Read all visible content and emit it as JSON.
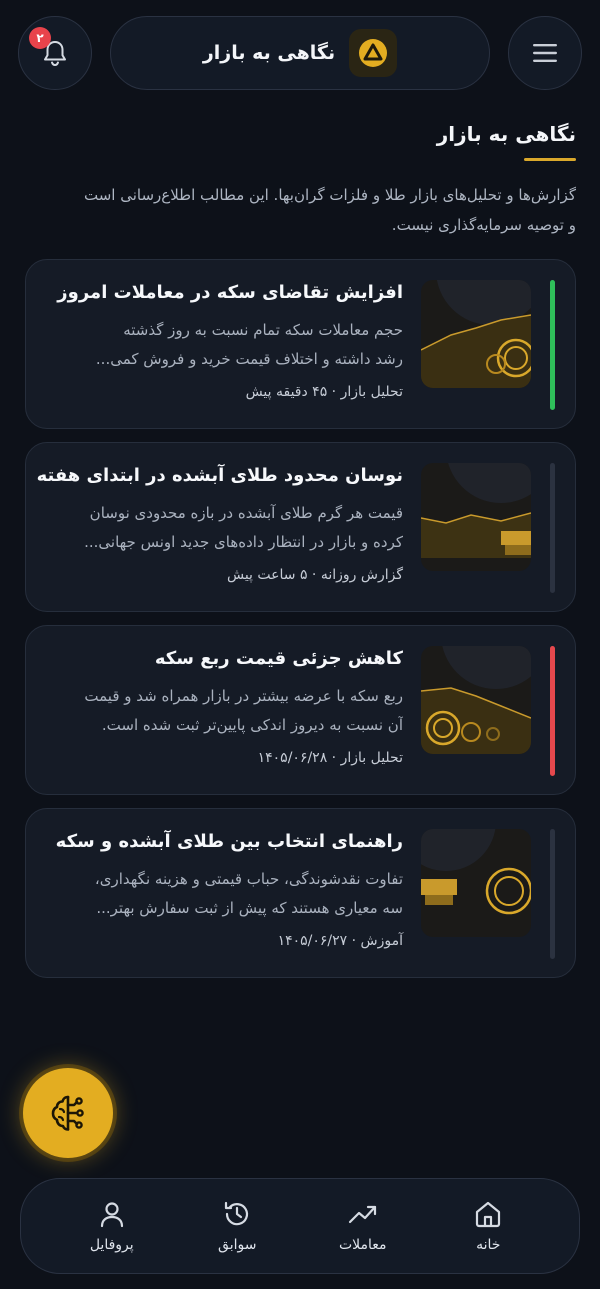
{
  "header": {
    "title": "نگاهی به بازار",
    "notification_count": "۲",
    "bell_icon": "bell-icon",
    "menu_icon": "hamburger-menu-icon",
    "logo_icon": "triangle-logo-icon"
  },
  "section": {
    "title": "نگاهی به بازار",
    "intro_line1": "گزارش‌ها و تحلیل‌های بازار طلا و فلزات گران‌بها. این مطالب اطلاع‌رسانی است",
    "intro_line2": "و توصیه سرمایه‌گذاری نیست."
  },
  "articles": [
    {
      "title": "افزایش تقاضای سکه در معاملات امروز",
      "desc_line1": "حجم معاملات سکه تمام نسبت به روز گذشته",
      "desc_line2": "رشد داشته و اختلاف قیمت خرید و فروش کمی...",
      "meta": "تحلیل بازار · ۴۵ دقیقه پیش",
      "status_color": "#2fbf5a"
    },
    {
      "title": "نوسان محدود طلای آبشده در ابتدای هفته",
      "desc_line1": "قیمت هر گرم طلای آبشده در بازه محدودی نوسان",
      "desc_line2": "کرده و بازار در انتظار داده‌های جدید اونس جهانی...",
      "meta": "گزارش روزانه · ۵ ساعت پیش",
      "status_color": "#2b3240"
    },
    {
      "title": "کاهش جزئی قیمت ربع سکه",
      "desc_line1": "ربع سکه با عرضه بیشتر در بازار همراه شد و قیمت",
      "desc_line2": "آن نسبت به دیروز اندکی پایین‌تر ثبت شده است.",
      "meta": "تحلیل بازار · ۱۴۰۵/۰۶/۲۸",
      "status_color": "#e5484d"
    },
    {
      "title": "راهنمای انتخاب بین طلای آبشده و سکه",
      "desc_line1": "تفاوت نقدشوندگی، حباب قیمتی و هزینه نگهداری،",
      "desc_line2": "سه معیاری هستند که پیش از ثبت سفارش بهتر...",
      "meta": "آموزش · ۱۴۰۵/۰۶/۲۷",
      "status_color": "#2b3240"
    }
  ],
  "fab": {
    "icon": "ai-brain-icon"
  },
  "nav": {
    "home": "خانه",
    "trades": "معاملات",
    "history": "سوابق",
    "profile": "پروفایل"
  },
  "colors": {
    "background": "#0d1119",
    "accent": "#e3ad21",
    "badge": "#e8434b"
  }
}
